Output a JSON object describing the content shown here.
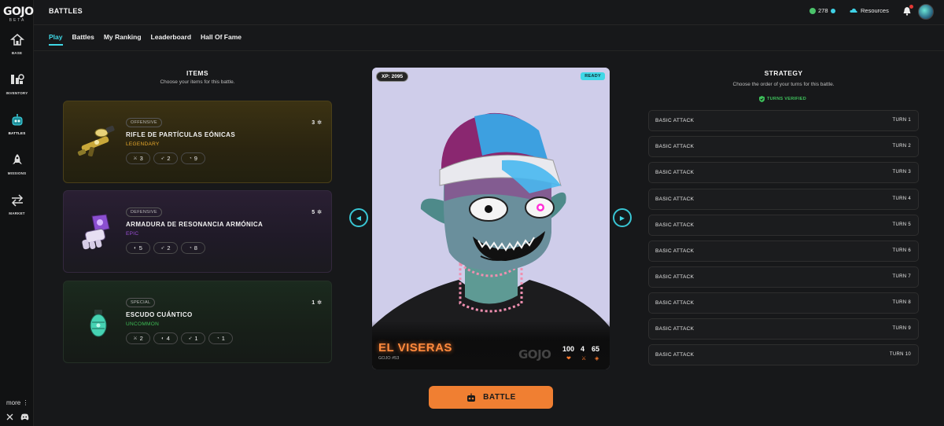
{
  "sidebar": {
    "logo": "GOJO",
    "logo_sub": "BETA",
    "items": [
      {
        "label": "BASE",
        "icon": "base-icon"
      },
      {
        "label": "INVENTORY",
        "icon": "inventory-icon"
      },
      {
        "label": "BATTLES",
        "icon": "robot-icon"
      },
      {
        "label": "MISSIONS",
        "icon": "rocket-icon"
      },
      {
        "label": "MARKET",
        "icon": "swap-arrows-icon"
      }
    ],
    "more": "more",
    "more_glyph": "⋮"
  },
  "header": {
    "title": "BATTLES",
    "balance": "278",
    "resources": "Resources"
  },
  "tabs": [
    "Play",
    "Battles",
    "My Ranking",
    "Leaderboard",
    "Hall Of Fame"
  ],
  "items": {
    "title": "ITEMS",
    "subtitle": "Choose your items for this battle.",
    "cards": [
      {
        "type": "OFFENSIVE",
        "name": "RIFLE DE PARTÍCULAS EÓNICAS",
        "rarity": "LEGENDARY",
        "count": "3",
        "stats": [
          {
            "icon": "sword-icon",
            "value": "3"
          },
          {
            "icon": "speed-icon",
            "value": "2"
          },
          {
            "icon": "cooldown-icon",
            "value": "9"
          }
        ]
      },
      {
        "type": "DEFENSIVE",
        "name": "ARMADURA DE RESONANCIA ARMÓNICA",
        "rarity": "EPIC",
        "count": "5",
        "stats": [
          {
            "icon": "shield-icon",
            "value": "5"
          },
          {
            "icon": "speed-icon",
            "value": "2"
          },
          {
            "icon": "cooldown-icon",
            "value": "8"
          }
        ]
      },
      {
        "type": "SPECIAL",
        "name": "ESCUDO CUÁNTICO",
        "rarity": "UNCOMMON",
        "count": "1",
        "stats": [
          {
            "icon": "sword-icon",
            "value": "2"
          },
          {
            "icon": "shield-icon",
            "value": "4"
          },
          {
            "icon": "speed-icon",
            "value": "1"
          },
          {
            "icon": "cooldown-icon",
            "value": "1"
          }
        ]
      }
    ]
  },
  "fighter": {
    "xp_label": "XP:",
    "xp": "2095",
    "status": "READY",
    "name": "EL VISERAS",
    "id": "GOJO #53",
    "brand": "GOJO",
    "stats": [
      "100",
      "4",
      "65"
    ]
  },
  "battle_button": "BATTLE",
  "strategy": {
    "title": "STRATEGY",
    "subtitle": "Choose the order of your turns for this battle.",
    "verified": "TURNS VERIFIED",
    "turns": [
      {
        "action": "BASIC ATTACK",
        "turn": "TURN 1"
      },
      {
        "action": "BASIC ATTACK",
        "turn": "TURN 2"
      },
      {
        "action": "BASIC ATTACK",
        "turn": "TURN 3"
      },
      {
        "action": "BASIC ATTACK",
        "turn": "TURN 4"
      },
      {
        "action": "BASIC ATTACK",
        "turn": "TURN 5"
      },
      {
        "action": "BASIC ATTACK",
        "turn": "TURN 6"
      },
      {
        "action": "BASIC ATTACK",
        "turn": "TURN 7"
      },
      {
        "action": "BASIC ATTACK",
        "turn": "TURN 8"
      },
      {
        "action": "BASIC ATTACK",
        "turn": "TURN 9"
      },
      {
        "action": "BASIC ATTACK",
        "turn": "TURN 10"
      }
    ]
  },
  "colors": {
    "accent": "#3fd8e6",
    "battle": "#f07f32",
    "legendary": "#e8a92c",
    "epic": "#9b4fd6",
    "uncommon": "#3ebd55"
  }
}
